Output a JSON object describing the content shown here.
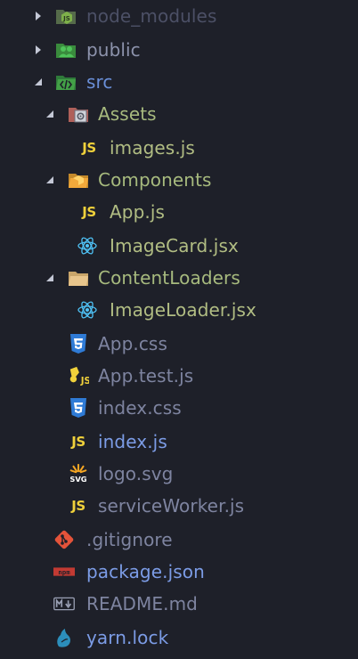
{
  "explorer": {
    "items": [
      {
        "label": "node_modules",
        "icon": "node-folder-icon",
        "expand": "collapsed",
        "color": "#4c5066"
      },
      {
        "label": "public",
        "icon": "public-folder-icon",
        "expand": "collapsed",
        "color": "#8d93ac"
      },
      {
        "label": "src",
        "icon": "src-folder-icon",
        "expand": "expanded",
        "color": "#6a8fd8"
      },
      {
        "label": "Assets",
        "icon": "assets-folder-icon",
        "expand": "expanded",
        "color": "#a7ba7e"
      },
      {
        "label": "images.js",
        "icon": "js-file-icon",
        "expand": "none",
        "color": "#b1bd83"
      },
      {
        "label": "Components",
        "icon": "components-folder-icon",
        "expand": "expanded",
        "color": "#a7ba7e"
      },
      {
        "label": "App.js",
        "icon": "js-file-icon",
        "expand": "none",
        "color": "#b1bd83"
      },
      {
        "label": "ImageCard.jsx",
        "icon": "react-icon",
        "expand": "none",
        "color": "#b1bd83"
      },
      {
        "label": "ContentLoaders",
        "icon": "folder-icon",
        "expand": "expanded",
        "color": "#a7ba7e"
      },
      {
        "label": "ImageLoader.jsx",
        "icon": "react-icon",
        "expand": "none",
        "color": "#b1bd83"
      },
      {
        "label": "App.css",
        "icon": "css-file-icon",
        "expand": "none",
        "color": "#7e84a0"
      },
      {
        "label": "App.test.js",
        "icon": "test-js-icon",
        "expand": "none",
        "color": "#7e84a0"
      },
      {
        "label": "index.css",
        "icon": "css-file-icon",
        "expand": "none",
        "color": "#7e84a0"
      },
      {
        "label": "index.js",
        "icon": "js-file-icon",
        "expand": "none",
        "color": "#7c9ce6"
      },
      {
        "label": "logo.svg",
        "icon": "svg-file-icon",
        "expand": "none",
        "color": "#7e84a0"
      },
      {
        "label": "serviceWorker.js",
        "icon": "js-file-icon",
        "expand": "none",
        "color": "#7e84a0"
      },
      {
        "label": ".gitignore",
        "icon": "git-icon",
        "expand": "none",
        "color": "#7e84a0"
      },
      {
        "label": "package.json",
        "icon": "npm-icon",
        "expand": "none",
        "color": "#7c9ce6"
      },
      {
        "label": "README.md",
        "icon": "markdown-icon",
        "expand": "none",
        "color": "#7e84a0"
      },
      {
        "label": "yarn.lock",
        "icon": "yarn-icon",
        "expand": "none",
        "color": "#7c9ce6"
      }
    ]
  }
}
